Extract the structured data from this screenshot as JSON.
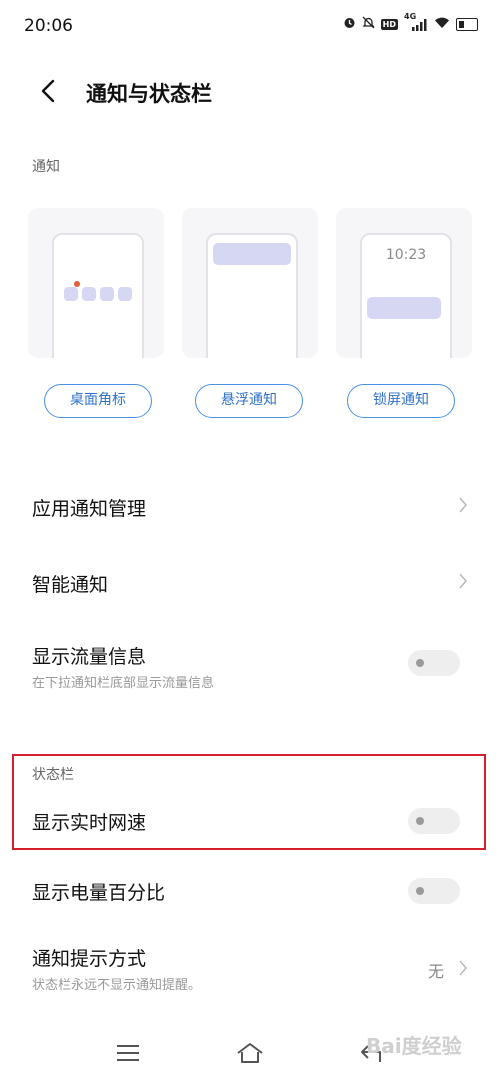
{
  "status_bar": {
    "time": "20:06",
    "icons": [
      "alarm-icon",
      "mute-icon",
      "hd-icon",
      "signal-4g-icon",
      "wifi-icon",
      "battery-icon"
    ],
    "hd_label": "HD",
    "network_label": "4G"
  },
  "header": {
    "title": "通知与状态栏"
  },
  "notification_section": {
    "label": "通知",
    "styles": [
      {
        "label": "桌面角标"
      },
      {
        "label": "悬浮通知"
      },
      {
        "label": "锁屏通知",
        "preview_time": "10:23"
      }
    ]
  },
  "settings": {
    "app_notification": {
      "title": "应用通知管理"
    },
    "smart_notification": {
      "title": "智能通知"
    },
    "show_traffic": {
      "title": "显示流量信息",
      "subtitle": "在下拉通知栏底部显示流量信息",
      "enabled": false
    }
  },
  "status_bar_section": {
    "label": "状态栏",
    "show_speed": {
      "title": "显示实时网速",
      "enabled": false
    },
    "battery_percent": {
      "title": "显示电量百分比",
      "enabled": false
    },
    "alert_style": {
      "title": "通知提示方式",
      "subtitle": "状态栏永远不显示通知提醒。",
      "value": "无"
    }
  },
  "nav_bar": {
    "buttons": [
      "menu-icon",
      "home-icon",
      "back-icon"
    ]
  },
  "watermark": "Bai度经验",
  "colors": {
    "accent": "#2f73c9",
    "highlight_box": "#d21f2b",
    "preview_fill": "#d6d8f3"
  }
}
